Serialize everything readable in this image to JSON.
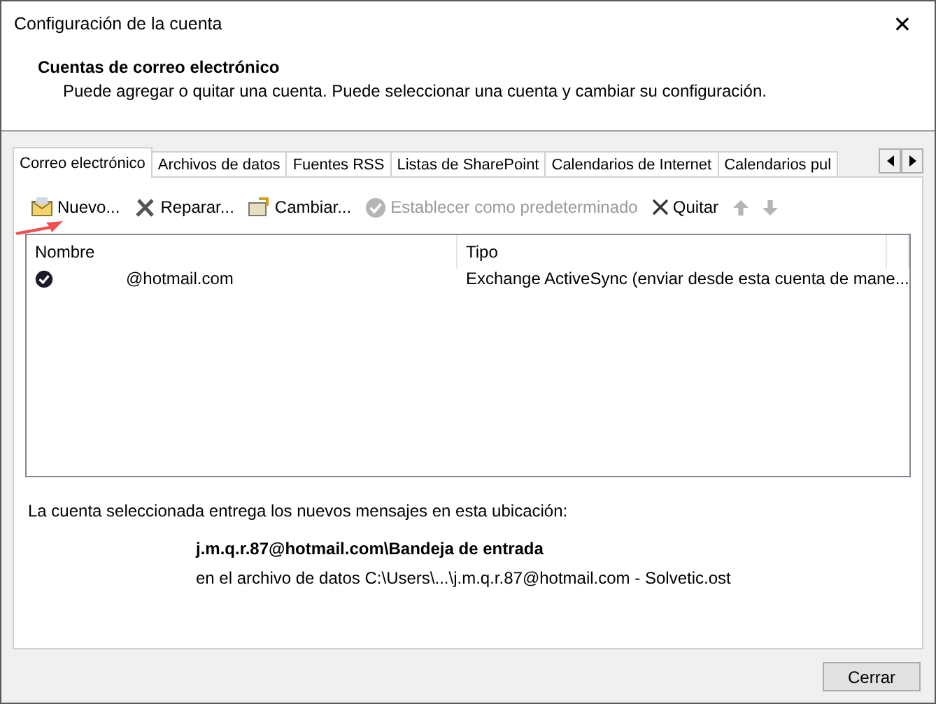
{
  "window": {
    "title": "Configuración de la cuenta",
    "close": "✕"
  },
  "header": {
    "title": "Cuentas de correo electrónico",
    "description": "Puede agregar o quitar una cuenta. Puede seleccionar una cuenta y cambiar su configuración."
  },
  "tabs": [
    {
      "label": "Correo electrónico",
      "selected": true
    },
    {
      "label": "Archivos de datos",
      "selected": false
    },
    {
      "label": "Fuentes RSS",
      "selected": false
    },
    {
      "label": "Listas de SharePoint",
      "selected": false
    },
    {
      "label": "Calendarios de Internet",
      "selected": false
    },
    {
      "label": "Calendarios pul",
      "selected": false
    }
  ],
  "toolbar": [
    {
      "kind": "new",
      "label": "Nuevo...",
      "disabled": false
    },
    {
      "kind": "repair",
      "label": "Reparar...",
      "disabled": false
    },
    {
      "kind": "change",
      "label": "Cambiar...",
      "disabled": false
    },
    {
      "kind": "default",
      "label": "Establecer como predeterminado",
      "disabled": true
    },
    {
      "kind": "remove",
      "label": "Quitar",
      "disabled": false
    },
    {
      "kind": "up",
      "disabled": true
    },
    {
      "kind": "down",
      "disabled": true
    }
  ],
  "table": {
    "columns": [
      "Nombre",
      "Tipo"
    ],
    "rows": [
      {
        "name": "@hotmail.com",
        "type": "Exchange ActiveSync (enviar desde esta cuenta de mane...",
        "default": true
      }
    ]
  },
  "delivery": {
    "intro": "La cuenta seleccionada entrega los nuevos mensajes en esta ubicación:",
    "folder": "j.m.q.r.87@hotmail.com\\Bandeja de entrada",
    "file": "en el archivo de datos C:\\Users\\...\\j.m.q.r.87@hotmail.com - Solvetic.ost"
  },
  "buttons": [
    "Cerrar"
  ]
}
